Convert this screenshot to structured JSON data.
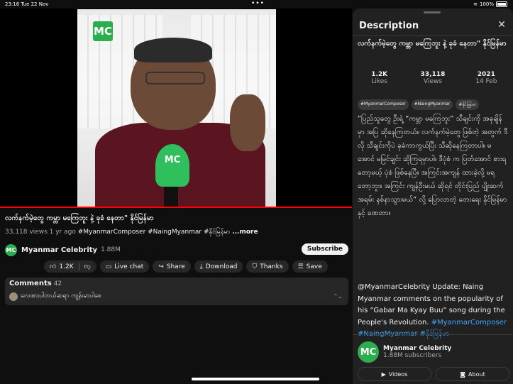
{
  "status_bar": {
    "time": "23:16",
    "date": "Tue 22 Nov",
    "dots": "•••",
    "battery": "100%"
  },
  "video": {
    "logo": "MC",
    "progress_fraction": 1.0
  },
  "title": "လက်နက်မဲ့တွေ ကမ္ဘာ မကြေဘူး နဲ့ ခုခံ နေတာ\" နိုင်မြန်မာ",
  "meta": {
    "views": "33,118 views",
    "ago": "1 yr ago",
    "tags": "#MyanmarComposer #NaingMyanmar #နိုင်မြန်မာ",
    "more": "...more"
  },
  "channel": {
    "avatar": "MC",
    "name": "Myanmar Celebrity",
    "subs": "1.88M",
    "subscribe_label": "Subscribe"
  },
  "actions": {
    "likes": "1.2K",
    "live_chat": "Live chat",
    "share": "Share",
    "download": "Download",
    "thanks": "Thanks",
    "save": "Save"
  },
  "comments": {
    "label": "Comments",
    "count": "42",
    "first_comment": "လေးစားပါတယ်ဆရာ ကျန်းမာပါစေ"
  },
  "panel": {
    "heading": "Description",
    "title": "လက်နက်မဲ့တွေ ကမ္ဘာ မကြေဘူး နဲ့ ခုခံ နေတာ\" နိုင်မြန်မာ",
    "stats": [
      {
        "n": "1.2K",
        "l": "Likes"
      },
      {
        "n": "33,118",
        "l": "Views"
      },
      {
        "n": "2021",
        "l": "14 Feb"
      }
    ],
    "chips": [
      "#MyanmarComposer",
      "#NaingMyanmar",
      "#နိုင်မြန်မာ"
    ],
    "description_mm": "“ပြည်သူတွေ ဦးရဲ့ “ကမ္ဘာ မကြေဘူး” သီချင်းကို အခုချိန်မှာ အပြ ဆိုနေကြတယ်။ လက်နက်မဲ့တွေ ဖြစ်တဲ့ အတွက် ဒီလို သီချင်းကိုပဲ ခုခံကာကွယ်ပြီး သီဆိုနေကြတာပါ။ မအောင် မမြင်ချင်း ဆိုကြရမှာပါ။ ဒီပုံစံ က ပြတ်အောင် စားရတော့မယ့် ပုံစံ ဖြစ်နေပြီ။ အကြင်းအကျန် ထားခဲ့လို့ မရတော့ဘူး။ အကြင်း ကျန်ဦးမယ် ဆိုရင် တိုင်းပြည် ပျိုးဆက် အရမ်း နစ်နာသွားမယ်” လို့ ပြောလာတဲ့ တေးရေး နိုင်မြန်မာ နှင့် ခဏတာ။",
    "description_en": "@MyanmarCelebrity Update: Naing Myanmar comments on the popularity of his “Gabar Ma Kyay Buu” song during the People's Revolution.",
    "links": [
      "#MyanmarComposer",
      "#NaingMyanmar #နိုင်မြန်မာ"
    ],
    "channel_name": "Myanmar Celebrity",
    "channel_subs": "1.88M subscribers",
    "videos_label": "Videos",
    "about_label": "About"
  }
}
